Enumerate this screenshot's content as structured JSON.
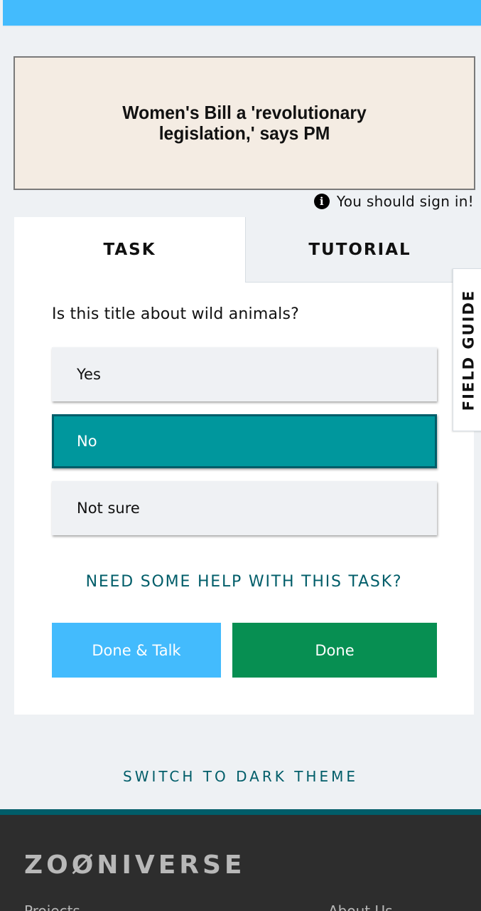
{
  "subject": {
    "headline": "Women's Bill a 'revolutionary legislation,' says PM"
  },
  "signin": {
    "icon": "info-icon",
    "icon_glyph": "i",
    "text": "You should sign in!"
  },
  "tabs": [
    {
      "label": "TASK",
      "active": true
    },
    {
      "label": "TUTORIAL",
      "active": false
    }
  ],
  "task": {
    "question": "Is this title about wild animals?",
    "answers": [
      {
        "label": "Yes",
        "selected": false
      },
      {
        "label": "No",
        "selected": true
      },
      {
        "label": "Not sure",
        "selected": false
      }
    ],
    "help_link": "NEED SOME HELP WITH THIS TASK?",
    "done_talk_label": "Done & Talk",
    "done_label": "Done"
  },
  "field_guide": {
    "label": "FIELD GUIDE"
  },
  "theme_switch": {
    "label": "SWITCH TO DARK THEME"
  },
  "footer": {
    "logo": "ZOØNIVERSE",
    "links": [
      "Projects",
      "About Us"
    ]
  },
  "colors": {
    "banner": "#43bbfd",
    "selected_answer": "#00979d",
    "selected_answer_border": "#005d69",
    "done_talk": "#43bbfd",
    "done": "#078f52",
    "link_teal": "#005d69",
    "footer_bg": "#2d2d2d"
  }
}
